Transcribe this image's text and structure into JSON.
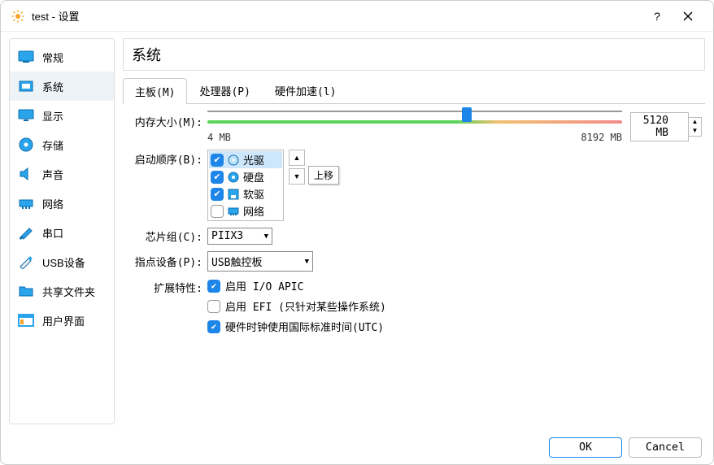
{
  "window_title": "test - 设置",
  "sidebar": {
    "items": [
      {
        "label": "常规"
      },
      {
        "label": "系统"
      },
      {
        "label": "显示"
      },
      {
        "label": "存储"
      },
      {
        "label": "声音"
      },
      {
        "label": "网络"
      },
      {
        "label": "串口"
      },
      {
        "label": "USB设备"
      },
      {
        "label": "共享文件夹"
      },
      {
        "label": "用户界面"
      }
    ]
  },
  "page_title": "系统",
  "tabs": {
    "motherboard": "主板(M)",
    "processor": "处理器(P)",
    "accel": "硬件加速(l)"
  },
  "memory": {
    "label": "内存大小(M):",
    "value": "5120",
    "unit": "MB",
    "min_label": "4 MB",
    "max_label": "8192 MB",
    "max": 8192
  },
  "boot": {
    "label": "启动顺序(B):",
    "items": [
      {
        "label": "光驱",
        "checked": true
      },
      {
        "label": "硬盘",
        "checked": true
      },
      {
        "label": "软驱",
        "checked": true
      },
      {
        "label": "网络",
        "checked": false
      }
    ],
    "tooltip": "上移"
  },
  "chipset": {
    "label": "芯片组(C):",
    "value": "PIIX3"
  },
  "pointing": {
    "label": "指点设备(P):",
    "value": "USB触控板"
  },
  "ext": {
    "label": "扩展特性:",
    "ioapic": "启用 I/O APIC",
    "efi": "启用 EFI (只针对某些操作系统)",
    "utc": "硬件时钟使用国际标准时间(UTC)"
  },
  "footer": {
    "ok": "OK",
    "cancel": "Cancel"
  }
}
